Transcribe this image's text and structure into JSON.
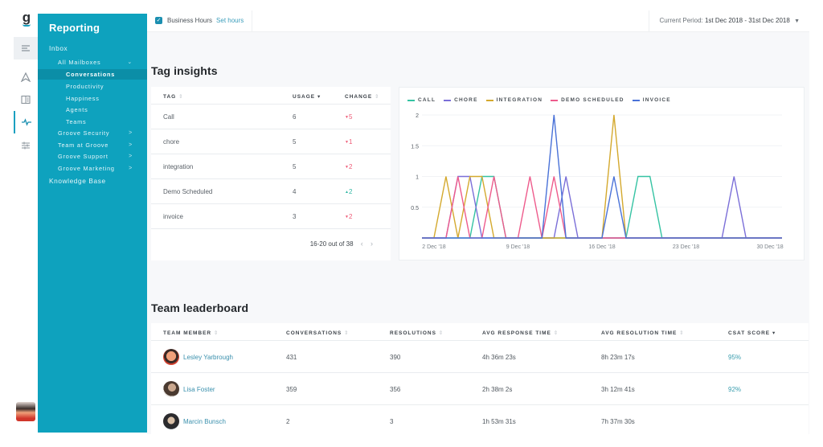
{
  "rail": {
    "logo": "g",
    "icons": [
      "menu-lines-icon",
      "send-arrow-icon",
      "book-icon",
      "activity-pulse-icon",
      "sliders-icon"
    ]
  },
  "sidebar": {
    "title": "Reporting",
    "items": [
      {
        "label": "Inbox",
        "level": 0
      },
      {
        "label": "All Mailboxes",
        "level": 1,
        "chevron": "expanded"
      },
      {
        "label": "Conversations",
        "level": 2,
        "active": true
      },
      {
        "label": "Productivity",
        "level": 2
      },
      {
        "label": "Happiness",
        "level": 2
      },
      {
        "label": "Agents",
        "level": 2
      },
      {
        "label": "Teams",
        "level": 2
      },
      {
        "label": "Groove Security",
        "level": 1,
        "chevron": "collapsed"
      },
      {
        "label": "Team at Groove",
        "level": 1,
        "chevron": "collapsed"
      },
      {
        "label": "Groove Support",
        "level": 1,
        "chevron": "collapsed"
      },
      {
        "label": "Groove Marketing",
        "level": 1,
        "chevron": "collapsed"
      },
      {
        "label": "Knowledge Base",
        "level": 0
      }
    ]
  },
  "topbar": {
    "business_hours_label": "Business Hours",
    "business_hours_checked": true,
    "set_hours_link": "Set hours",
    "period_label": "Current Period:",
    "period_value": "1st Dec 2018 - 31st Dec 2018"
  },
  "tag_insights": {
    "title": "Tag insights",
    "columns": {
      "tag": "TAG",
      "usage": "USAGE",
      "change": "CHANGE"
    },
    "rows": [
      {
        "tag": "Call",
        "usage": "6",
        "change": "5",
        "direction": "down"
      },
      {
        "tag": "chore",
        "usage": "5",
        "change": "1",
        "direction": "down"
      },
      {
        "tag": "integration",
        "usage": "5",
        "change": "2",
        "direction": "down"
      },
      {
        "tag": "Demo Scheduled",
        "usage": "4",
        "change": "2",
        "direction": "up"
      },
      {
        "tag": "invoice",
        "usage": "3",
        "change": "2",
        "direction": "down"
      }
    ],
    "pagination": "16-20 out of 38"
  },
  "chart_data": {
    "type": "line",
    "title": "",
    "xlabel": "",
    "ylabel": "",
    "x": [
      "1 Dec",
      "2 Dec",
      "3 Dec",
      "4 Dec",
      "5 Dec",
      "6 Dec",
      "7 Dec",
      "8 Dec",
      "9 Dec",
      "10 Dec",
      "11 Dec",
      "12 Dec",
      "13 Dec",
      "14 Dec",
      "15 Dec",
      "16 Dec",
      "17 Dec",
      "18 Dec",
      "19 Dec",
      "20 Dec",
      "21 Dec",
      "22 Dec",
      "23 Dec",
      "24 Dec",
      "25 Dec",
      "26 Dec",
      "27 Dec",
      "28 Dec",
      "29 Dec",
      "30 Dec",
      "31 Dec"
    ],
    "x_tick_labels": [
      "2 Dec '18",
      "9 Dec '18",
      "16 Dec '18",
      "23 Dec '18",
      "30 Dec '18"
    ],
    "x_tick_indices": [
      1,
      8,
      15,
      22,
      29
    ],
    "y_ticks": [
      "0.5",
      "1",
      "1.5",
      "2"
    ],
    "ylim": [
      0,
      2
    ],
    "grid": true,
    "legend_position": "top-left",
    "series": [
      {
        "name": "CALL",
        "color": "#35c3a3",
        "values": [
          0,
          0,
          0,
          0,
          0,
          1,
          1,
          0,
          0,
          0,
          0,
          0,
          0,
          0,
          0,
          0,
          0,
          0,
          1,
          1,
          0,
          0,
          0,
          0,
          0,
          0,
          0,
          0,
          0,
          0,
          0
        ]
      },
      {
        "name": "CHORE",
        "color": "#7b6fd8",
        "values": [
          0,
          0,
          0,
          1,
          1,
          0,
          0,
          0,
          0,
          0,
          0,
          0,
          1,
          0,
          0,
          0,
          0,
          0,
          0,
          0,
          0,
          0,
          0,
          0,
          0,
          0,
          1,
          0,
          0,
          0,
          0
        ]
      },
      {
        "name": "INTEGRATION",
        "color": "#d4a92e",
        "values": [
          0,
          0,
          1,
          0,
          1,
          1,
          0,
          0,
          0,
          0,
          0,
          0,
          0,
          0,
          0,
          0,
          2,
          0,
          0,
          0,
          0,
          0,
          0,
          0,
          0,
          0,
          0,
          0,
          0,
          0,
          0
        ]
      },
      {
        "name": "DEMO SCHEDULED",
        "color": "#ee5b8c",
        "values": [
          0,
          0,
          0,
          1,
          0,
          0,
          1,
          0,
          0,
          1,
          0,
          1,
          0,
          0,
          0,
          0,
          0,
          0,
          0,
          0,
          0,
          0,
          0,
          0,
          0,
          0,
          0,
          0,
          0,
          0,
          0
        ]
      },
      {
        "name": "INVOICE",
        "color": "#4a72d8",
        "values": [
          0,
          0,
          0,
          0,
          0,
          0,
          0,
          0,
          0,
          0,
          0,
          2,
          0,
          0,
          0,
          0,
          1,
          0,
          0,
          0,
          0,
          0,
          0,
          0,
          0,
          0,
          0,
          0,
          0,
          0,
          0
        ]
      }
    ]
  },
  "leaderboard": {
    "title": "Team leaderboard",
    "columns": {
      "member": "TEAM MEMBER",
      "conversations": "CONVERSATIONS",
      "resolutions": "RESOLUTIONS",
      "avg_response": "AVG RESPONSE TIME",
      "avg_resolution": "AVG RESOLUTION TIME",
      "csat": "CSAT SCORE"
    },
    "rows": [
      {
        "name": "Lesley Yarbrough",
        "conversations": "431",
        "resolutions": "390",
        "avg_response": "4h 36m 23s",
        "avg_resolution": "8h 23m 17s",
        "csat": "95%"
      },
      {
        "name": "Lisa Foster",
        "conversations": "359",
        "resolutions": "356",
        "avg_response": "2h 38m 2s",
        "avg_resolution": "3h 12m 41s",
        "csat": "92%"
      },
      {
        "name": "Marcin Bunsch",
        "conversations": "2",
        "resolutions": "3",
        "avg_response": "1h 53m 31s",
        "avg_resolution": "7h 37m 30s",
        "csat": ""
      }
    ]
  }
}
